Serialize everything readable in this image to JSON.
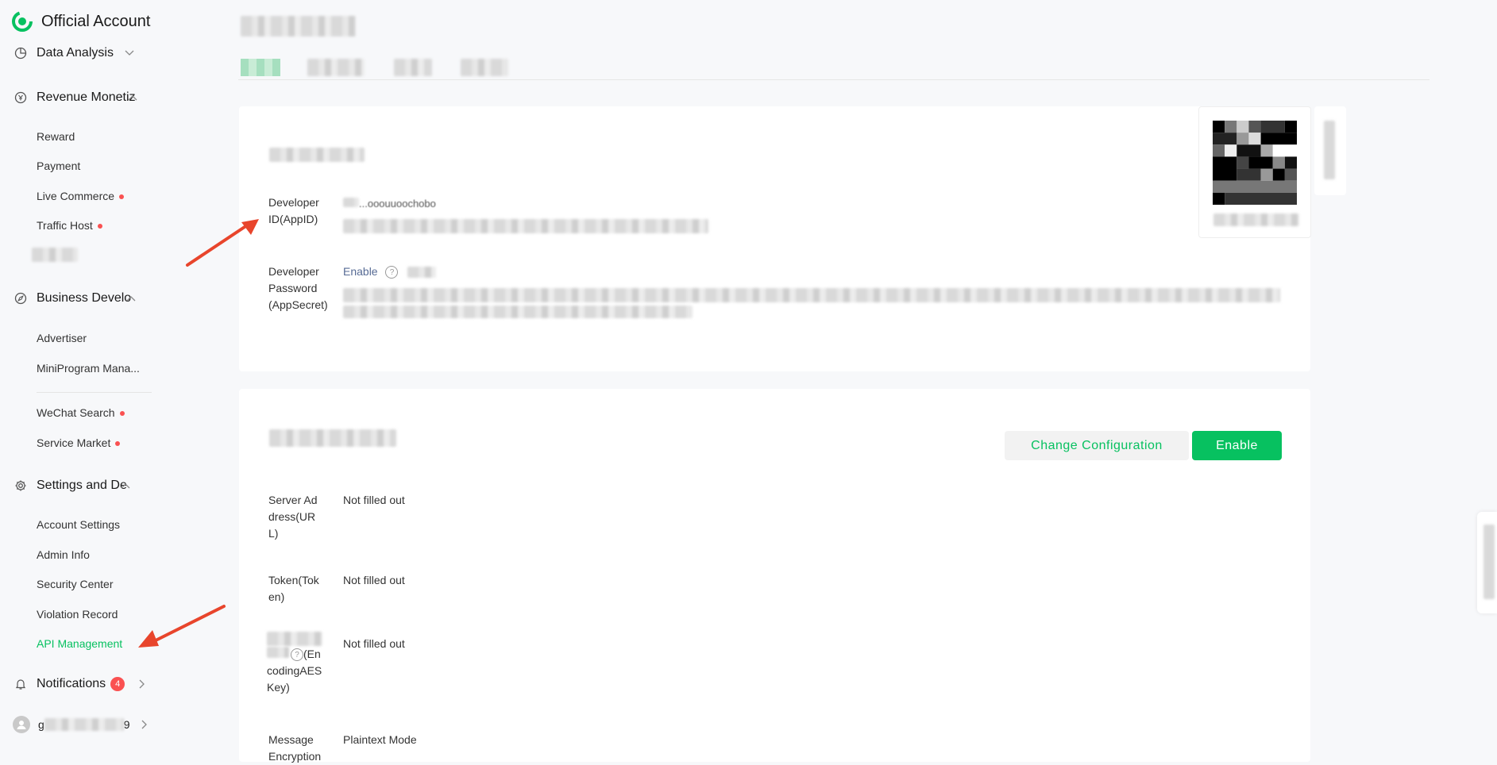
{
  "brand": {
    "name": "Official Account",
    "accent": "#07c160"
  },
  "sidebar": {
    "groups": {
      "data_analysis": "Data Analysis",
      "revenue": "Revenue Monetiz",
      "business": "Business Develo",
      "settings": "Settings and De"
    },
    "revenue_items": [
      "Reward",
      "Payment",
      "Live Commerce",
      "Traffic Host"
    ],
    "business_items": [
      "Advertiser",
      "MiniProgram Mana...",
      "WeChat Search",
      "Service Market"
    ],
    "settings_items": [
      "Account Settings",
      "Admin Info",
      "Security Center",
      "Violation Record",
      "API Management"
    ],
    "notifications": {
      "label": "Notifications",
      "count": "4"
    },
    "account": {
      "prefix": "g",
      "suffix": "9"
    }
  },
  "developer_card": {
    "appid_label": "Developer ID(AppID)",
    "appid_partial": "...ooouuoochobo",
    "secret_label": "Developer Password (AppSecret)",
    "secret_action": "Enable",
    "help": "?"
  },
  "server_card": {
    "change_button": "Change Configuration",
    "enable_button": "Enable",
    "url_label": "Server Address(URL)",
    "url_value": "Not filled out",
    "token_label": "Token(Token)",
    "token_value": "Not filled out",
    "aes_label": "(EncodingAESKey)",
    "aes_value": "Not filled out",
    "msg_label": "Message Encryption",
    "msg_value": "Plaintext Mode"
  }
}
